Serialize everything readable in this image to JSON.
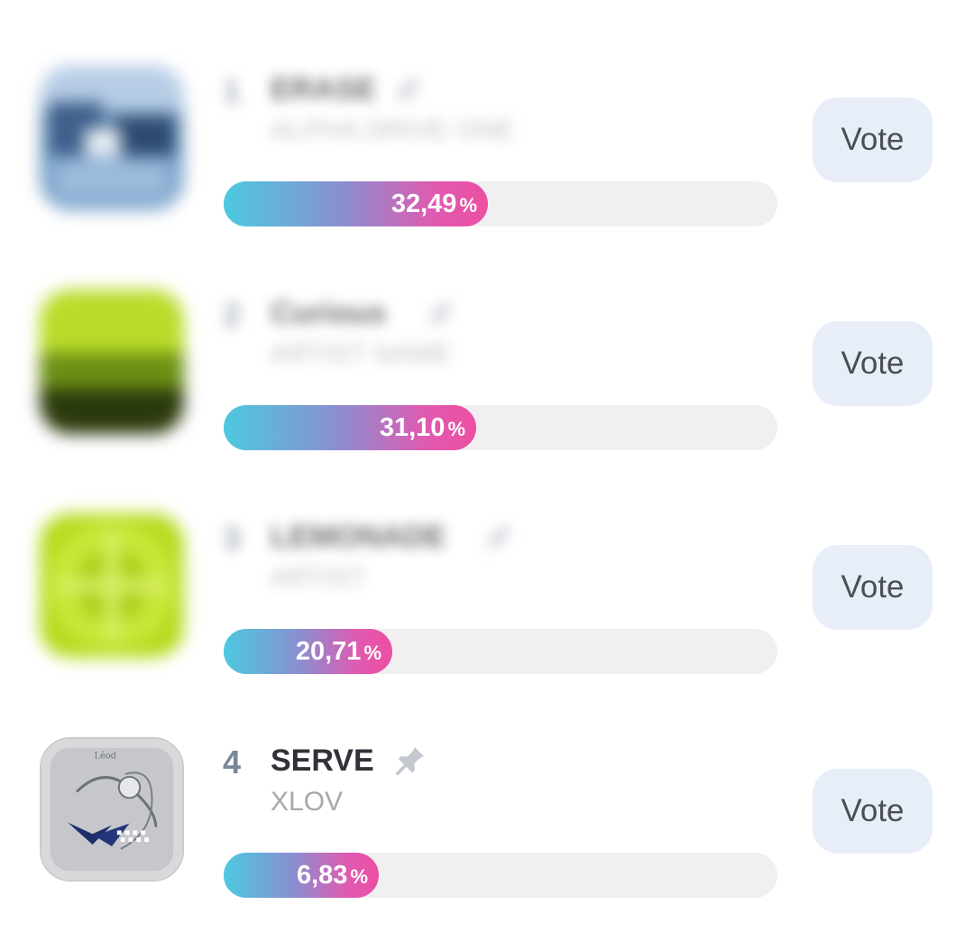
{
  "poll": {
    "entries": [
      {
        "rank": "1",
        "title": "ERASE",
        "artist": "ALPHA DRIVE ONE",
        "percent": "32,49",
        "percent_sign": "%",
        "share": 32.49,
        "vote_label": "Vote",
        "details_obscured": true,
        "cover_icon": "album-cover-blue"
      },
      {
        "rank": "2",
        "title": "Curious",
        "artist": "ARTIST NAME",
        "percent": "31,10",
        "percent_sign": "%",
        "share": 31.1,
        "vote_label": "Vote",
        "details_obscured": true,
        "cover_icon": "album-cover-green"
      },
      {
        "rank": "3",
        "title": "LEMONADE",
        "artist": "ARTIST",
        "percent": "20,71",
        "percent_sign": "%",
        "share": 20.71,
        "vote_label": "Vote",
        "details_obscured": true,
        "cover_icon": "album-cover-lime"
      },
      {
        "rank": "4",
        "title": "SERVE",
        "artist": "XLOV",
        "percent": "6,83",
        "percent_sign": "%",
        "share": 6.83,
        "vote_label": "Vote",
        "details_obscured": false,
        "cover_icon": "album-cover-silver"
      }
    ]
  },
  "colors": {
    "bar_gradient_start": "#4cc9e0",
    "bar_gradient_end": "#ec4fa1",
    "track": "#f0f0f2",
    "vote_button_bg": "#e8eef8",
    "rank": "#7b879a",
    "title": "#2f3238",
    "artist": "#a5a8ad"
  },
  "icons": {
    "pin": "pin-icon"
  }
}
